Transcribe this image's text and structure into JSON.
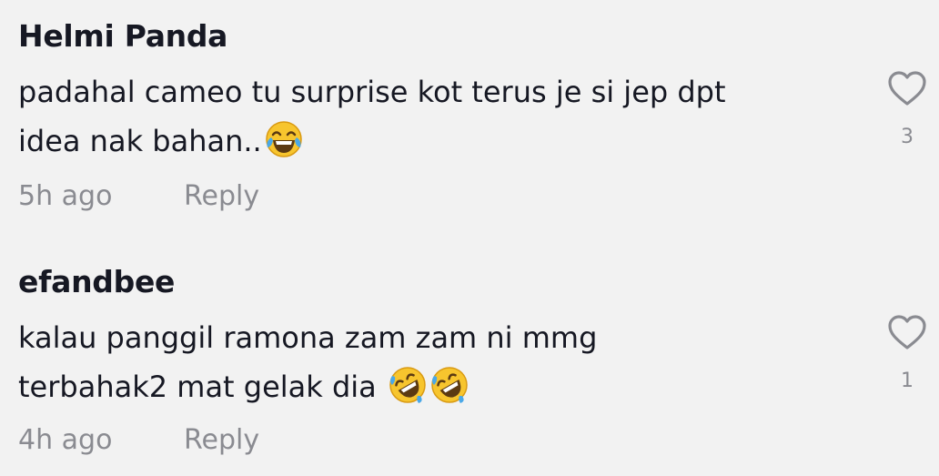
{
  "comments": [
    {
      "username": "Helmi Panda",
      "line1": "padahal cameo tu surprise kot terus je si jep dpt",
      "line2": "idea nak bahan..",
      "emojis": [
        "tears-of-joy-emoji"
      ],
      "time": "5h ago",
      "reply_label": "Reply",
      "like_count": "3"
    },
    {
      "username": "efandbee",
      "line1": "kalau panggil ramona zam zam ni mmg",
      "line2": "terbahak2 mat gelak dia ",
      "emojis": [
        "rolling-on-floor-laughing-emoji",
        "rolling-on-floor-laughing-emoji"
      ],
      "time": "4h ago",
      "reply_label": "Reply",
      "like_count": "1"
    }
  ],
  "colors": {
    "background": "#f2f2f2",
    "text": "#161823",
    "muted": "#8a8b91",
    "emoji_face": "#f7c52e"
  }
}
